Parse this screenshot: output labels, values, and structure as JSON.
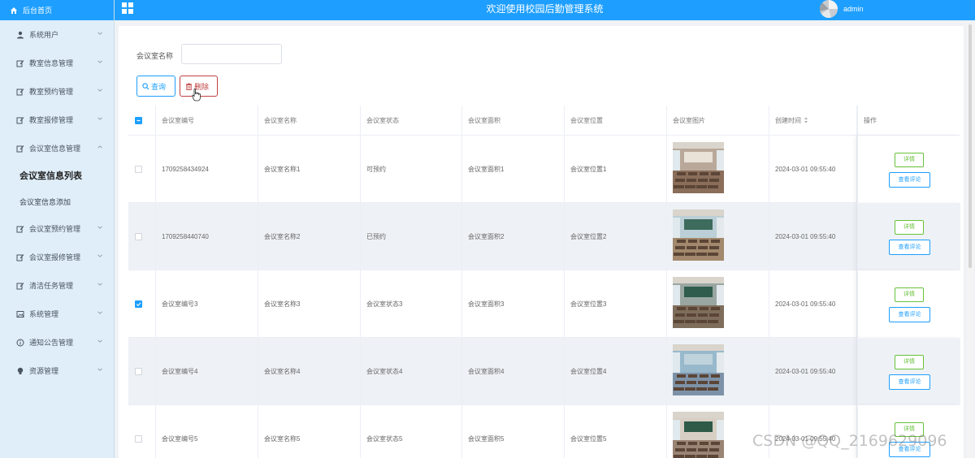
{
  "sidebar": {
    "brand": "后台首页",
    "items": [
      {
        "label": "系统用户",
        "icon": "user-icon"
      },
      {
        "label": "教室信息管理",
        "icon": "edit-icon"
      },
      {
        "label": "教室预约管理",
        "icon": "edit-icon"
      },
      {
        "label": "教室报修管理",
        "icon": "edit-icon"
      },
      {
        "label": "会议室信息管理",
        "icon": "edit-icon",
        "expanded": true
      },
      {
        "label": "会议室预约管理",
        "icon": "edit-icon"
      },
      {
        "label": "会议室报修管理",
        "icon": "edit-icon"
      },
      {
        "label": "清洁任务管理",
        "icon": "edit-icon"
      },
      {
        "label": "系统管理",
        "icon": "image-icon"
      },
      {
        "label": "通知公告管理",
        "icon": "info-icon"
      },
      {
        "label": "资源管理",
        "icon": "bulb-icon"
      }
    ],
    "submenu": [
      "会议室信息列表",
      "会议室信息添加"
    ]
  },
  "header": {
    "title": "欢迎使用校园后勤管理系统",
    "user": "admin"
  },
  "search": {
    "label": "会议室名称",
    "value": "",
    "query_button": "查询",
    "delete_button": "删除"
  },
  "table": {
    "columns": [
      "会议室编号",
      "会议室名称",
      "会议室状态",
      "会议室面积",
      "会议室位置",
      "会议室图片",
      "创建时间",
      "操作"
    ],
    "rows": [
      {
        "id": "1709258434924",
        "name": "会议室名称1",
        "status": "可预约",
        "area": "会议室面积1",
        "location": "会议室位置1",
        "created": "2024-03-01 09:55:40",
        "checked": false
      },
      {
        "id": "1709258440740",
        "name": "会议室名称2",
        "status": "已预约",
        "area": "会议室面积2",
        "location": "会议室位置2",
        "created": "2024-03-01 09:55:40",
        "checked": false
      },
      {
        "id": "会议室编号3",
        "name": "会议室名称3",
        "status": "会议室状态3",
        "area": "会议室面积3",
        "location": "会议室位置3",
        "created": "2024-03-01 09:55:40",
        "checked": true
      },
      {
        "id": "会议室编号4",
        "name": "会议室名称4",
        "status": "会议室状态4",
        "area": "会议室面积4",
        "location": "会议室位置4",
        "created": "2024-03-01 09:55:40",
        "checked": false
      },
      {
        "id": "会议室编号5",
        "name": "会议室名称5",
        "status": "会议室状态5",
        "area": "会议室面积5",
        "location": "会议室位置5",
        "created": "2024-03-01 09:55:40",
        "checked": false
      }
    ],
    "detail_label": "详情",
    "review_label": "查看评论"
  },
  "watermark": "CSDN @QQ_2169629096",
  "colors": {
    "primary": "#1e9fff",
    "danger": "#c04040",
    "success": "#67c23a",
    "sidebar_bg": "#dfeef9"
  }
}
